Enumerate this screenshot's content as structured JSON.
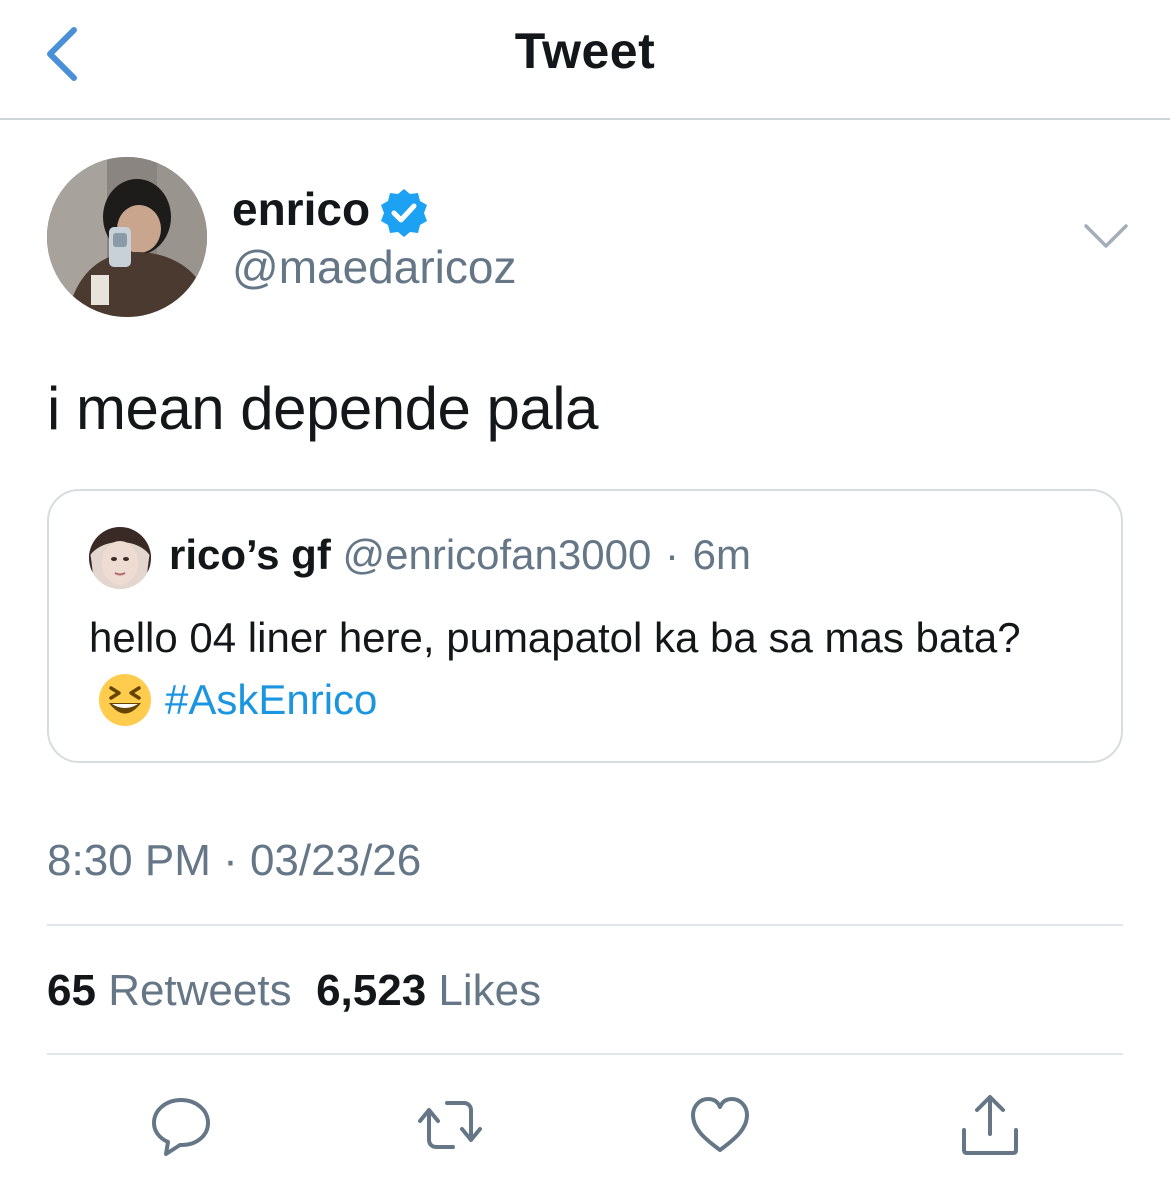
{
  "header": {
    "title": "Tweet",
    "back_icon": "chevron-left-icon"
  },
  "tweet": {
    "author": {
      "name": "enrico",
      "handle": "@maedaricoz",
      "verified": true,
      "verified_icon": "verified-badge-icon"
    },
    "menu_icon": "chevron-down-icon",
    "text": "i mean depende pala",
    "quote": {
      "name": "rico’s gf",
      "handle": "@enricofan3000",
      "separator": "·",
      "time": "6m",
      "text": "hello 04 liner here, pumapatol ka ba sa mas bata?",
      "emoji": "grinning-squinting-face-emoji",
      "hashtag": "#AskEnrico"
    },
    "timestamp": "8:30 PM · 03/23/26",
    "stats": {
      "retweets_count": "65",
      "retweets_label": "Retweets",
      "likes_count": "6,523",
      "likes_label": "Likes"
    },
    "actions": [
      {
        "icon": "reply-icon"
      },
      {
        "icon": "retweet-icon"
      },
      {
        "icon": "like-icon"
      },
      {
        "icon": "share-icon"
      }
    ]
  },
  "colors": {
    "accent": "#1b95e0",
    "back_accent": "#4a90d9",
    "text_primary": "#14171a",
    "text_secondary": "#657786",
    "divider": "#e1e6ea",
    "icon_gray": "#657786"
  }
}
